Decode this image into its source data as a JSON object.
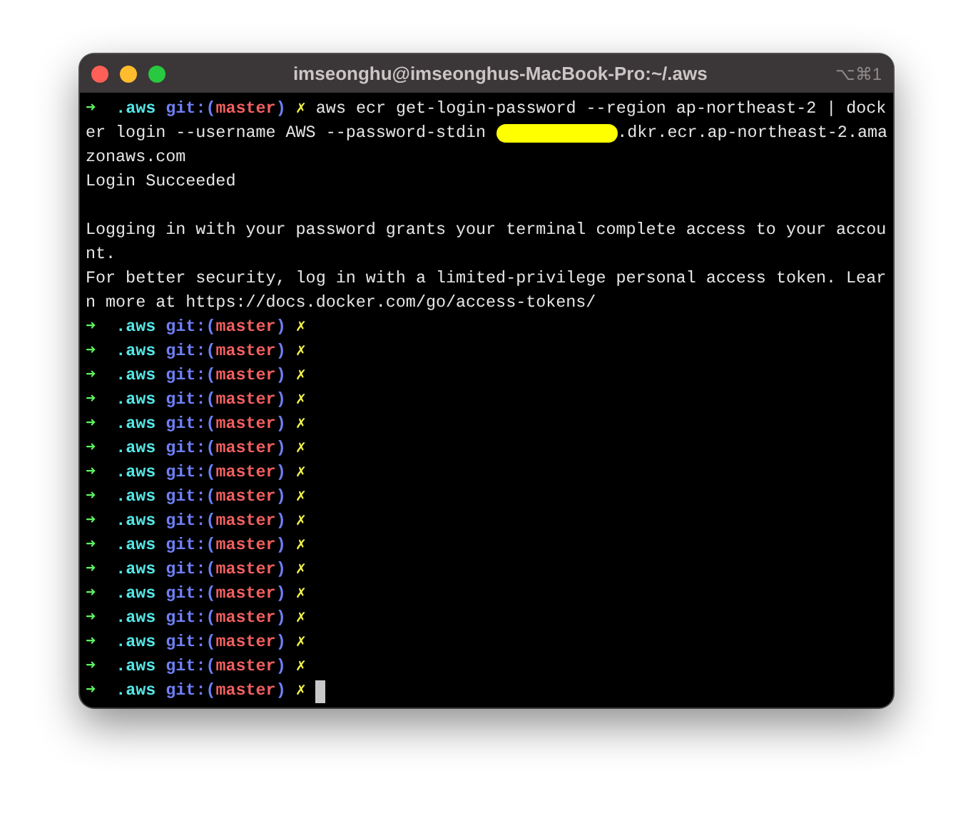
{
  "window": {
    "title": "imseonghu@imseonghus-MacBook-Pro:~/.aws",
    "shortcut": "⌥⌘1"
  },
  "lines": [
    {
      "kind": "prompt",
      "arrow": "➜",
      "dir": ".aws",
      "git_open": "git:(",
      "branch": "master",
      "git_close": ")",
      "dirty": "✗",
      "command": "aws ecr get-login-password --region ap-northeast-2 | dock",
      "cursor": false
    },
    {
      "kind": "redacted",
      "before": "er login --username AWS --password-stdin ",
      "after": ".dkr.ecr.ap-northeast-2.ama"
    },
    {
      "kind": "output",
      "text": "zonaws.com"
    },
    {
      "kind": "output",
      "text": "Login Succeeded"
    },
    {
      "kind": "blank"
    },
    {
      "kind": "output",
      "text": "Logging in with your password grants your terminal complete access to your accou"
    },
    {
      "kind": "output",
      "text": "nt."
    },
    {
      "kind": "output",
      "text": "For better security, log in with a limited-privilege personal access token. Lear"
    },
    {
      "kind": "output",
      "text": "n more at https://docs.docker.com/go/access-tokens/"
    },
    {
      "kind": "prompt",
      "arrow": "➜",
      "dir": ".aws",
      "git_open": "git:(",
      "branch": "master",
      "git_close": ")",
      "dirty": "✗",
      "cursor": false
    },
    {
      "kind": "prompt",
      "arrow": "➜",
      "dir": ".aws",
      "git_open": "git:(",
      "branch": "master",
      "git_close": ")",
      "dirty": "✗",
      "cursor": false
    },
    {
      "kind": "prompt",
      "arrow": "➜",
      "dir": ".aws",
      "git_open": "git:(",
      "branch": "master",
      "git_close": ")",
      "dirty": "✗",
      "cursor": false
    },
    {
      "kind": "prompt",
      "arrow": "➜",
      "dir": ".aws",
      "git_open": "git:(",
      "branch": "master",
      "git_close": ")",
      "dirty": "✗",
      "cursor": false
    },
    {
      "kind": "prompt",
      "arrow": "➜",
      "dir": ".aws",
      "git_open": "git:(",
      "branch": "master",
      "git_close": ")",
      "dirty": "✗",
      "cursor": false
    },
    {
      "kind": "prompt",
      "arrow": "➜",
      "dir": ".aws",
      "git_open": "git:(",
      "branch": "master",
      "git_close": ")",
      "dirty": "✗",
      "cursor": false
    },
    {
      "kind": "prompt",
      "arrow": "➜",
      "dir": ".aws",
      "git_open": "git:(",
      "branch": "master",
      "git_close": ")",
      "dirty": "✗",
      "cursor": false
    },
    {
      "kind": "prompt",
      "arrow": "➜",
      "dir": ".aws",
      "git_open": "git:(",
      "branch": "master",
      "git_close": ")",
      "dirty": "✗",
      "cursor": false
    },
    {
      "kind": "prompt",
      "arrow": "➜",
      "dir": ".aws",
      "git_open": "git:(",
      "branch": "master",
      "git_close": ")",
      "dirty": "✗",
      "cursor": false
    },
    {
      "kind": "prompt",
      "arrow": "➜",
      "dir": ".aws",
      "git_open": "git:(",
      "branch": "master",
      "git_close": ")",
      "dirty": "✗",
      "cursor": false
    },
    {
      "kind": "prompt",
      "arrow": "➜",
      "dir": ".aws",
      "git_open": "git:(",
      "branch": "master",
      "git_close": ")",
      "dirty": "✗",
      "cursor": false
    },
    {
      "kind": "prompt",
      "arrow": "➜",
      "dir": ".aws",
      "git_open": "git:(",
      "branch": "master",
      "git_close": ")",
      "dirty": "✗",
      "cursor": false
    },
    {
      "kind": "prompt",
      "arrow": "➜",
      "dir": ".aws",
      "git_open": "git:(",
      "branch": "master",
      "git_close": ")",
      "dirty": "✗",
      "cursor": false
    },
    {
      "kind": "prompt",
      "arrow": "➜",
      "dir": ".aws",
      "git_open": "git:(",
      "branch": "master",
      "git_close": ")",
      "dirty": "✗",
      "cursor": false
    },
    {
      "kind": "prompt",
      "arrow": "➜",
      "dir": ".aws",
      "git_open": "git:(",
      "branch": "master",
      "git_close": ")",
      "dirty": "✗",
      "cursor": false
    },
    {
      "kind": "prompt",
      "arrow": "➜",
      "dir": ".aws",
      "git_open": "git:(",
      "branch": "master",
      "git_close": ")",
      "dirty": "✗",
      "cursor": true
    }
  ]
}
